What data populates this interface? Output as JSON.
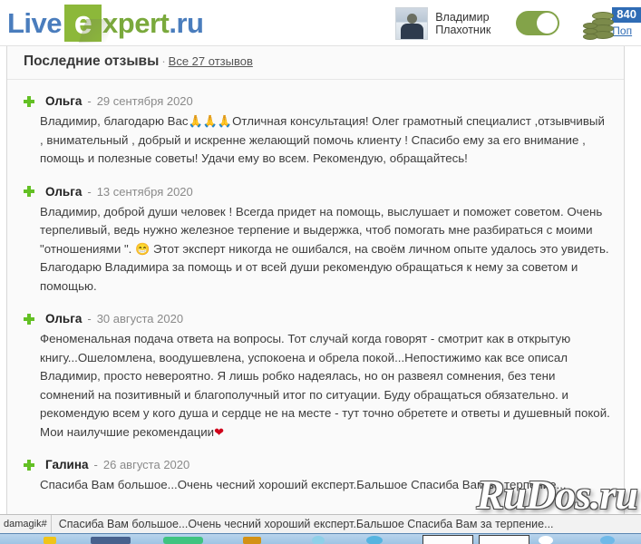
{
  "header": {
    "logo": {
      "part1": "Live",
      "tile": "e",
      "part2": "xpert",
      "part3": ".ru",
      "blue_color": "#4a7dbd",
      "green_color": "#7aa93c",
      "tile_bg": "#8cb83a"
    },
    "user": {
      "name_line1": "Владимир",
      "name_line2": "Плахотник",
      "avatar_alt": "avatar"
    },
    "toggle": {
      "state": "on",
      "color": "#83a349"
    },
    "balance": {
      "amount": "840",
      "topup_label": "Поп",
      "badge_color": "#2f6cb5",
      "coin_color": "#7b8a4a"
    }
  },
  "section": {
    "title": "Последние отзывы",
    "separator": "·",
    "all_reviews_link": "Все 27 отзывов"
  },
  "reviews": [
    {
      "author": "Ольга",
      "dash": "-",
      "date": "29 сентября 2020",
      "text_before": "Владимир, благодарю Вас",
      "emoji": "🙏🙏🙏",
      "text_after": "Отличная консультация! Олег грамотный специалист ,отзывчивый , внимательный , добрый и искренне желающий помочь клиенту ! Спасибо ему за его внимание , помощь и полезные советы! Удачи ему во всем. Рекомендую, обращайтесь!"
    },
    {
      "author": "Ольга",
      "dash": "-",
      "date": "13 сентября 2020",
      "text_before": "Владимир, доброй души человек ! Всегда придет на помощь, выслушает и поможет советом. Очень терпеливый, ведь нужно железное терпение и выдержка, чтоб помогать мне разбираться с моими \"отношениями \".",
      "emoji": "😁",
      "text_after": "Этот эксперт никогда не ошибался, на своём личном опыте удалось это увидеть. Благодарю Владимира за помощь и от всей души рекомендую обращаться к нему за советом и помощью."
    },
    {
      "author": "Ольга",
      "dash": "-",
      "date": "30 августа 2020",
      "text_before": "Феноменальная подача ответа на вопросы. Тот случай когда говорят - смотрит как в открытую книгу...Ошеломлена, воодушевлена, успокоена и обрела покой...Непостижимо как все описал Владимир, просто невероятно. Я лишь робко надеялась, но он развеял сомнения, без тени сомнений на позитивный и благополучный итог по ситуации. Буду обращаться обязательно. и рекомендую всем у кого душа и сердце не на месте - тут точно обретете и ответы и душевный покой. Мои наилучшие рекомендации",
      "emoji": "❤",
      "text_after": ""
    },
    {
      "author": "Галина",
      "dash": "-",
      "date": "26 августа 2020",
      "text_before": "Спасиба Вам большое...Очень чесний хороший експерт.Бальшое Спасиба Вам за терпение...",
      "emoji": "",
      "text_after": ""
    }
  ],
  "watermark": {
    "text": "RuDos.ru"
  },
  "bottom_bar": {
    "tab_left_label": "damagik#",
    "tab_main_label": "Спасиба Вам большое...Очень чесний хороший експерт.Бальшое Спасиба Вам за терпение..."
  }
}
